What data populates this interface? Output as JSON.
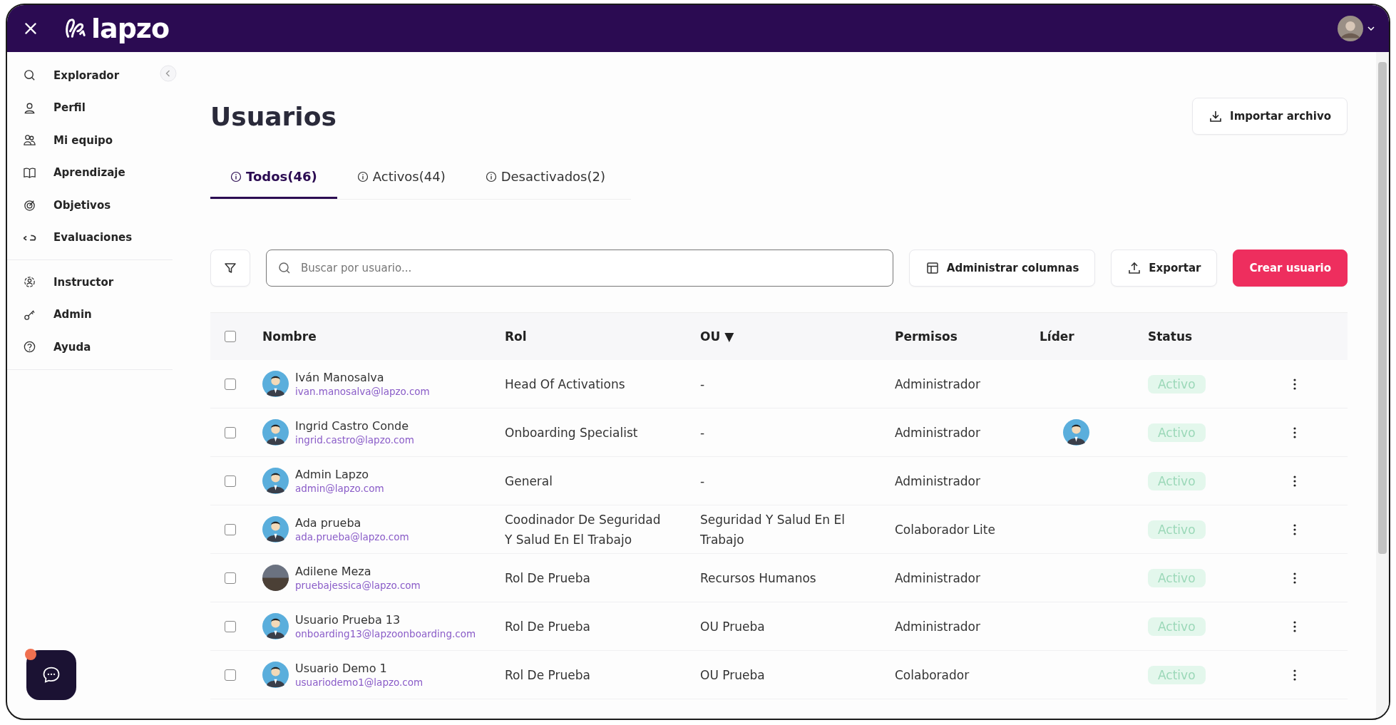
{
  "app": {
    "logo": "lapzo"
  },
  "sidebar": {
    "sections": [
      {
        "items": [
          {
            "label": "Explorador"
          },
          {
            "label": "Perfil"
          },
          {
            "label": "Mi equipo"
          },
          {
            "label": "Aprendizaje"
          },
          {
            "label": "Objetivos"
          },
          {
            "label": "Evaluaciones"
          }
        ]
      },
      {
        "items": [
          {
            "label": "Instructor"
          },
          {
            "label": "Admin"
          },
          {
            "label": "Ayuda"
          }
        ]
      }
    ]
  },
  "page": {
    "title": "Usuarios",
    "import_button": "Importar archivo"
  },
  "tabs": [
    {
      "label": "Todos(46)",
      "selected": true
    },
    {
      "label": "Activos(44)",
      "selected": false
    },
    {
      "label": "Desactivados(2)",
      "selected": false
    }
  ],
  "toolbar": {
    "search": {
      "placeholder": "Buscar por usuario..."
    },
    "columns_button": "Administrar columnas",
    "export_button": "Exportar",
    "create_button": "Crear usuario"
  },
  "table": {
    "select_all": {
      "checked": false
    },
    "columns": [
      "Nombre",
      "Rol",
      "OU ▼",
      "Permisos",
      "Líder",
      "Status"
    ],
    "rows": [
      {
        "checked": false,
        "name": "Iván Manosalva",
        "email": "ivan.manosalva@lapzo.com",
        "has_photo": false,
        "role": "Head Of Activations",
        "ou": "-",
        "permissions": "Administrador",
        "has_leader": false,
        "status": "Activo"
      },
      {
        "checked": false,
        "name": "Ingrid Castro Conde",
        "email": "ingrid.castro@lapzo.com",
        "has_photo": false,
        "role": "Onboarding Specialist",
        "ou": "-",
        "permissions": "Administrador",
        "has_leader": true,
        "status": "Activo"
      },
      {
        "checked": false,
        "name": "Admin Lapzo",
        "email": "admin@lapzo.com",
        "has_photo": false,
        "role": "General",
        "ou": "-",
        "permissions": "Administrador",
        "has_leader": false,
        "status": "Activo"
      },
      {
        "checked": false,
        "name": "Ada prueba",
        "email": "ada.prueba@lapzo.com",
        "has_photo": false,
        "role": "Coodinador De Seguridad Y Salud En El Trabajo",
        "ou": "Seguridad Y Salud En El Trabajo",
        "permissions": "Colaborador Lite",
        "has_leader": false,
        "status": "Activo"
      },
      {
        "checked": false,
        "name": "Adilene Meza",
        "email": "pruebajessica@lapzo.com",
        "has_photo": true,
        "role": "Rol De Prueba",
        "ou": "Recursos Humanos",
        "permissions": "Administrador",
        "has_leader": false,
        "status": "Activo"
      },
      {
        "checked": false,
        "name": "Usuario Prueba 13",
        "email": "onboarding13@lapzoonboarding.com",
        "has_photo": false,
        "role": "Rol De Prueba",
        "ou": "OU Prueba",
        "permissions": "Administrador",
        "has_leader": false,
        "status": "Activo"
      },
      {
        "checked": false,
        "name": "Usuario Demo 1",
        "email": "usuariodemo1@lapzo.com",
        "has_photo": false,
        "role": "Rol De Prueba",
        "ou": "OU Prueba",
        "permissions": "Colaborador",
        "has_leader": false,
        "status": "Activo"
      }
    ]
  },
  "chat": {
    "has_notification": true
  }
}
